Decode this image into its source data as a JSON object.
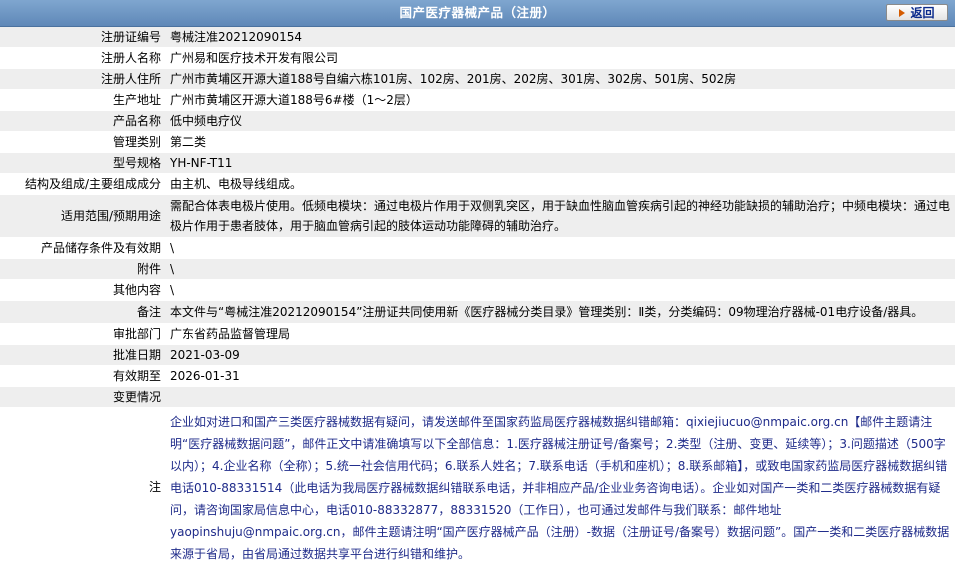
{
  "header": {
    "title": "国产医疗器械产品（注册）",
    "back_label": "返回"
  },
  "rows": [
    {
      "key": "注册证编号",
      "value": "粤械注准20212090154"
    },
    {
      "key": "注册人名称",
      "value": "广州易和医疗技术开发有限公司"
    },
    {
      "key": "注册人住所",
      "value": "广州市黄埔区开源大道188号自编六栋101房、102房、201房、202房、301房、302房、501房、502房"
    },
    {
      "key": "生产地址",
      "value": "广州市黄埔区开源大道188号6#楼（1～2层）"
    },
    {
      "key": "产品名称",
      "value": "低中频电疗仪"
    },
    {
      "key": "管理类别",
      "value": "第二类"
    },
    {
      "key": "型号规格",
      "value": "YH-NF-T11"
    },
    {
      "key": "结构及组成/主要组成成分",
      "value": "由主机、电极导线组成。"
    },
    {
      "key": "适用范围/预期用途",
      "value": "需配合体表电极片使用。低频电模块：通过电极片作用于双侧乳突区，用于缺血性脑血管疾病引起的神经功能缺损的辅助治疗；中频电模块：通过电极片作用于患者肢体，用于脑血管病引起的肢体运动功能障碍的辅助治疗。"
    },
    {
      "key": "产品储存条件及有效期",
      "value": "\\"
    },
    {
      "key": "附件",
      "value": "\\"
    },
    {
      "key": "其他内容",
      "value": "\\"
    },
    {
      "key": "备注",
      "value": "本文件与“粤械注准20212090154”注册证共同使用新《医疗器械分类目录》管理类别：Ⅱ类，分类编码：09物理治疗器械-01电疗设备/器具。"
    },
    {
      "key": "审批部门",
      "value": "广东省药品监督管理局"
    },
    {
      "key": "批准日期",
      "value": "2021-03-09"
    },
    {
      "key": "有效期至",
      "value": "2026-01-31"
    },
    {
      "key": "变更情况",
      "value": ""
    },
    {
      "key": "注",
      "value": "企业如对进口和国产三类医疗器械数据有疑问，请发送邮件至国家药监局医疗器械数据纠错邮箱：qixiejiucuo@nmpaic.org.cn【邮件主题请注明“医疗器械数据问题”，邮件正文中请准确填写以下全部信息：1.医疗器械注册证号/备案号；2.类型（注册、变更、延续等）；3.问题描述（500字以内）；4.企业名称（全称）；5.统一社会信用代码；6.联系人姓名；7.联系电话（手机和座机）；8.联系邮箱】，或致电国家药监局医疗器械数据纠错电话010-88331514（此电话为我局医疗器械数据纠错联系电话，并非相应产品/企业业务咨询电话）。企业如对国产一类和二类医疗器械数据有疑问，请咨询国家局信息中心，电话010-88332877，88331520（工作日），也可通过发邮件与我们联系：邮件地址yaopinshuju@nmpaic.org.cn，邮件主题请注明“国产医疗器械产品（注册）-数据（注册证号/备案号）数据问题”。国产一类和二类医疗器械数据来源于省局，由省局通过数据共享平台进行纠错和维护。"
    }
  ]
}
